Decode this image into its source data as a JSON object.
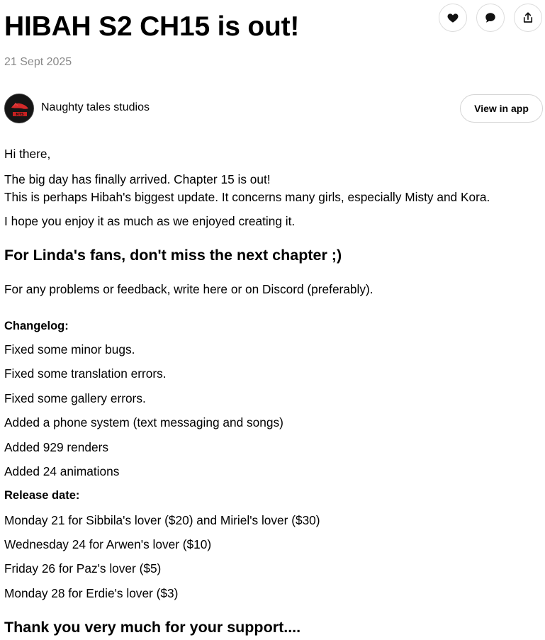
{
  "post": {
    "title": "HIBAH S2 CH15 is out!",
    "date": "21 Sept 2025",
    "author": "Naughty tales studios",
    "view_in_app": "View in app"
  },
  "actions": [
    {
      "icon": "heart-icon"
    },
    {
      "icon": "comment-icon"
    },
    {
      "icon": "share-icon"
    }
  ],
  "body": {
    "greeting": "Hi there,",
    "line1": "The big day has finally arrived. Chapter 15 is out!",
    "line2": "This is perhaps Hibah's biggest update. It concerns many girls, especially Misty and Kora.",
    "line3": "I hope you enjoy it as much as we enjoyed creating it.",
    "heading1": "For Linda's fans, don't miss the next chapter ;)",
    "feedback": "For any problems or feedback, write here or on Discord (preferably).",
    "changelog_title": "Changelog:",
    "changelog": [
      "Fixed some minor bugs.",
      "Fixed some translation errors.",
      "Fixed some gallery errors.",
      "Added a phone system (text messaging and songs)",
      "Added 929 renders",
      "Added 24 animations"
    ],
    "release_title": "Release date:",
    "releases": [
      "Monday 21 for Sibbila's lover ($20) and Miriel's lover ($30)",
      "Wednesday 24 for Arwen's lover ($10)",
      "Friday 26 for Paz's lover ($5)",
      "Monday 28 for Erdie's lover ($3)"
    ],
    "closing": "Thank you very much for your support...."
  }
}
